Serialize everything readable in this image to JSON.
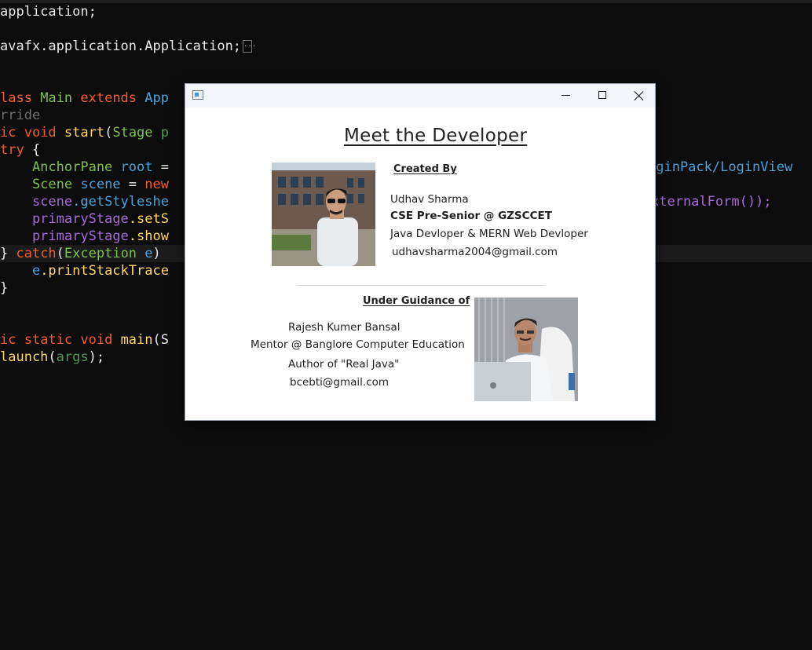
{
  "editor": {
    "lines": [
      {
        "segments": [
          {
            "t": "application;",
            "c": ""
          }
        ]
      },
      {
        "segments": [
          {
            "t": "",
            "c": ""
          }
        ]
      },
      {
        "segments": [
          {
            "t": "avafx.application.Application;",
            "c": ""
          }
        ],
        "fold": "..."
      },
      {
        "segments": [
          {
            "t": "",
            "c": ""
          }
        ]
      },
      {
        "segments": [
          {
            "t": "",
            "c": ""
          }
        ]
      },
      {
        "segments": [
          {
            "t": "lass ",
            "c": "kw"
          },
          {
            "t": "Main ",
            "c": "cl"
          },
          {
            "t": "extends ",
            "c": "kw"
          },
          {
            "t": "App",
            "c": "va"
          }
        ]
      },
      {
        "segments": [
          {
            "t": "rride",
            "c": "cm"
          }
        ]
      },
      {
        "segments": [
          {
            "t": "ic ",
            "c": "kw"
          },
          {
            "t": "void ",
            "c": "kw"
          },
          {
            "t": "start",
            "c": "fn"
          },
          {
            "t": "(",
            "c": ""
          },
          {
            "t": "Stage ",
            "c": "cl"
          },
          {
            "t": "p",
            "c": "ar"
          }
        ]
      },
      {
        "segments": [
          {
            "t": "try ",
            "c": "kw"
          },
          {
            "t": "{",
            "c": ""
          }
        ]
      },
      {
        "segments": [
          {
            "t": "    AnchorPane ",
            "c": "cl"
          },
          {
            "t": "root ",
            "c": "va"
          },
          {
            "t": "=",
            "c": ""
          }
        ]
      },
      {
        "segments": [
          {
            "t": "    Scene ",
            "c": "cl"
          },
          {
            "t": "scene ",
            "c": "va"
          },
          {
            "t": "= ",
            "c": ""
          },
          {
            "t": "new",
            "c": "kw"
          }
        ]
      },
      {
        "segments": [
          {
            "t": "    scene",
            "c": "ob"
          },
          {
            "t": ".getStyleshe",
            "c": "va"
          }
        ]
      },
      {
        "segments": [
          {
            "t": "    primaryStage",
            "c": "ob"
          },
          {
            "t": ".setS",
            "c": "fn"
          }
        ]
      },
      {
        "segments": [
          {
            "t": "    primaryStage",
            "c": "ob"
          },
          {
            "t": ".show",
            "c": "fn"
          }
        ]
      },
      {
        "segments": [
          {
            "t": "} ",
            "c": ""
          },
          {
            "t": "catch",
            "c": "kw"
          },
          {
            "t": "(",
            "c": ""
          },
          {
            "t": "Exception ",
            "c": "cl"
          },
          {
            "t": "e",
            "c": "va"
          },
          {
            "t": ")",
            "c": ""
          }
        ],
        "current": true
      },
      {
        "segments": [
          {
            "t": "    e",
            "c": "va"
          },
          {
            "t": ".printStackTrace",
            "c": "fn"
          }
        ]
      },
      {
        "segments": [
          {
            "t": "}",
            "c": ""
          }
        ]
      },
      {
        "segments": [
          {
            "t": "",
            "c": ""
          }
        ]
      },
      {
        "segments": [
          {
            "t": "",
            "c": ""
          }
        ]
      },
      {
        "segments": [
          {
            "t": "ic ",
            "c": "kw"
          },
          {
            "t": "static ",
            "c": "kw"
          },
          {
            "t": "void ",
            "c": "kw"
          },
          {
            "t": "main",
            "c": "fn"
          },
          {
            "t": "(S",
            "c": ""
          }
        ]
      },
      {
        "segments": [
          {
            "t": "launch",
            "c": "fn"
          },
          {
            "t": "(",
            "c": ""
          },
          {
            "t": "args",
            "c": "ar"
          },
          {
            "t": ");",
            "c": ""
          }
        ]
      }
    ],
    "right_fragments": [
      {
        "text": "oginPack/LoginView",
        "c": "va"
      },
      {
        "text": "xternalForm());",
        "c": "ob"
      }
    ]
  },
  "dialog": {
    "heading": "Meet the Developer",
    "created_by_label": "Created By",
    "developer": {
      "name": "Udhav Sharma",
      "role": "CSE Pre-Senior @ GZSCCET",
      "skills": "Java Devloper & MERN Web Devloper",
      "email": "udhavsharma2004@gmail.com"
    },
    "guidance_label": "Under Guidance of",
    "mentor": {
      "name": "Rajesh Kumer Bansal",
      "role": "Mentor @ Banglore Computer Education",
      "author": "Author of \"Real Java\"",
      "email": "bcebti@gmail.com"
    },
    "photos": {
      "developer": "developer-photo",
      "mentor": "mentor-photo"
    }
  }
}
